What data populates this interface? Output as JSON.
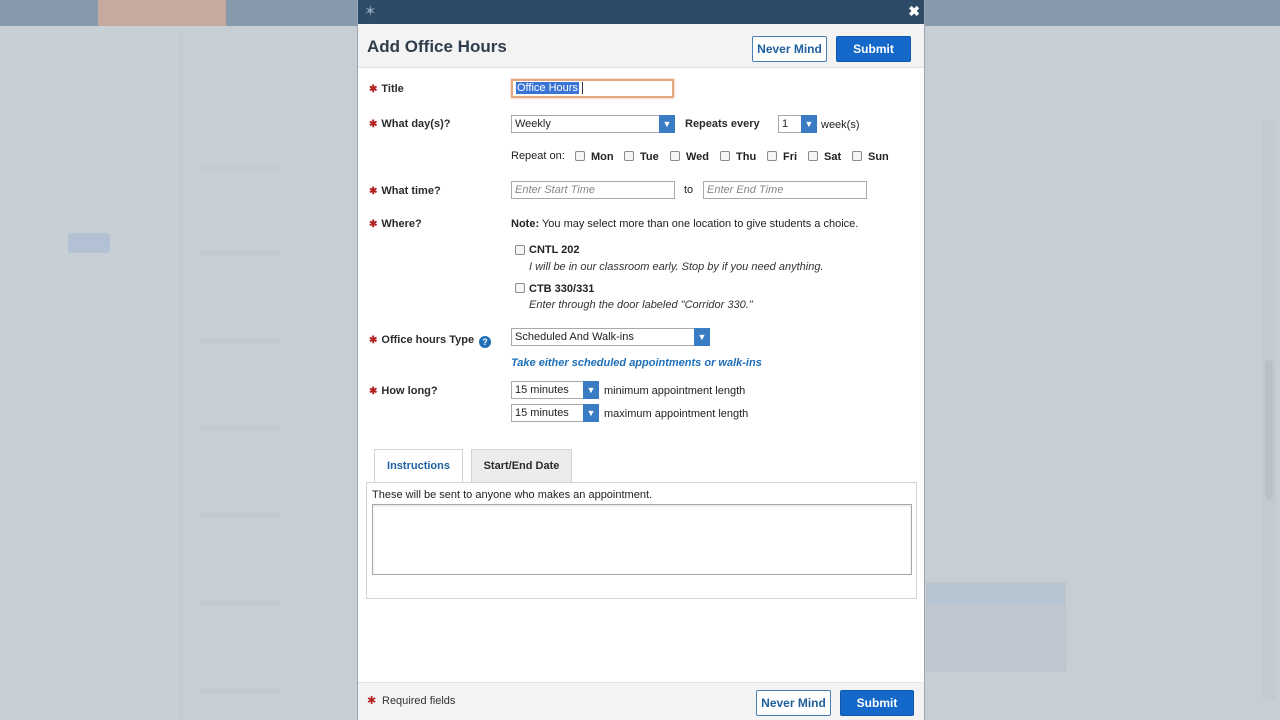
{
  "dialog": {
    "title": "Add Office Hours",
    "close_glyph": "✖",
    "logo_glyph": "✶",
    "never_mind_label": "Never Mind",
    "submit_label": "Submit"
  },
  "form": {
    "title": {
      "label": "Title",
      "value": "Office Hours"
    },
    "days": {
      "label": "What day(s)?",
      "frequency": "Weekly",
      "repeats_label": "Repeats every",
      "repeat_count": "1",
      "unit": "week(s)",
      "repeat_on_label": "Repeat on:",
      "weekdays": [
        "Mon",
        "Tue",
        "Wed",
        "Thu",
        "Fri",
        "Sat",
        "Sun"
      ]
    },
    "time": {
      "label": "What time?",
      "start_placeholder": "Enter Start Time",
      "to_label": "to",
      "end_placeholder": "Enter End Time"
    },
    "where": {
      "label": "Where?",
      "note_label": "Note:",
      "note_text": "You may select more than one location to give students a choice.",
      "locations": [
        {
          "name": "CNTL 202",
          "description": "I will be in our classroom early. Stop by if you need anything."
        },
        {
          "name": "CTB 330/331",
          "description": "Enter through the door labeled \"Corridor 330.\""
        }
      ]
    },
    "type": {
      "label": "Office hours Type",
      "value": "Scheduled And Walk-ins",
      "description": "Take either scheduled appointments or walk-ins"
    },
    "length": {
      "label": "How long?",
      "min_value": "15 minutes",
      "min_label": "minimum appointment length",
      "max_value": "15 minutes",
      "max_label": "maximum appointment length"
    }
  },
  "tabs": [
    {
      "label": "Instructions",
      "active": true
    },
    {
      "label": "Start/End Date",
      "active": false
    }
  ],
  "instructions": {
    "hint": "These will be sent to anyone who makes an appointment.",
    "text": ""
  },
  "footer": {
    "required_label": "Required fields",
    "never_mind_label": "Never Mind",
    "submit_label": "Submit"
  },
  "colors": {
    "primary_button": "#1468c9",
    "header_bar": "#2d4a67",
    "required_star": "#b22222",
    "accent_link": "#1d6fb8",
    "focus_border": "#e3a882"
  }
}
